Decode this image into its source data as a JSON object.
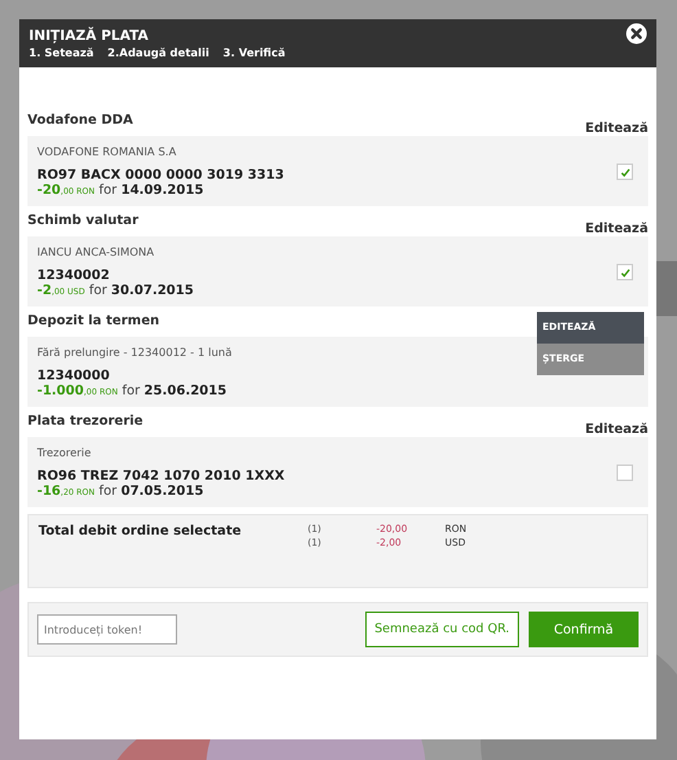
{
  "modal": {
    "title": "INIȚIAZĂ PLATA",
    "steps": [
      "1. Setează",
      "2.Adaugă detalii",
      "3. Verifică"
    ]
  },
  "sections": [
    {
      "title": "Vodafone DDA",
      "edit": "Editează",
      "party": "VODAFONE ROMANIA S.A",
      "account": "RO97 BACX 0000 0000 3019 3313",
      "amount": "-20",
      "decimals": ",00",
      "currency": "RON",
      "for": "for",
      "date": "14.09.2015",
      "checked": true
    },
    {
      "title": "Schimb valutar",
      "edit": "Editează",
      "party": "IANCU ANCA-SIMONA",
      "account": "12340002",
      "amount": "-2",
      "decimals": ",00",
      "currency": "USD",
      "for": "for",
      "date": "30.07.2015",
      "checked": true
    },
    {
      "title": "Depozit la termen",
      "party": "Fără prelungire - 12340012 - 1 lună",
      "account": "12340000",
      "amount": "-1.000",
      "decimals": ",00",
      "currency": "RON",
      "for": "for",
      "date": "25.06.2015",
      "menu": [
        "EDITEAZĂ",
        "ȘTERGE"
      ]
    },
    {
      "title": "Plata trezorerie",
      "edit": "Editează",
      "party": "Trezorerie",
      "account": "RO96 TREZ 7042 1070 2010 1XXX",
      "amount": "-16",
      "decimals": ",20",
      "currency": "RON",
      "for": "for",
      "date": "07.05.2015",
      "checked": false
    }
  ],
  "total": {
    "label": "Total debit ordine selectate",
    "rows": [
      {
        "count": "(1)",
        "amount": "-20,00",
        "currency": "RON"
      },
      {
        "count": "(1)",
        "amount": "-2,00",
        "currency": "USD"
      }
    ]
  },
  "footer": {
    "token_placeholder": "Introduceți token!",
    "qr_button": "Semnează cu cod QR.",
    "confirm_button": "Confirmă"
  }
}
